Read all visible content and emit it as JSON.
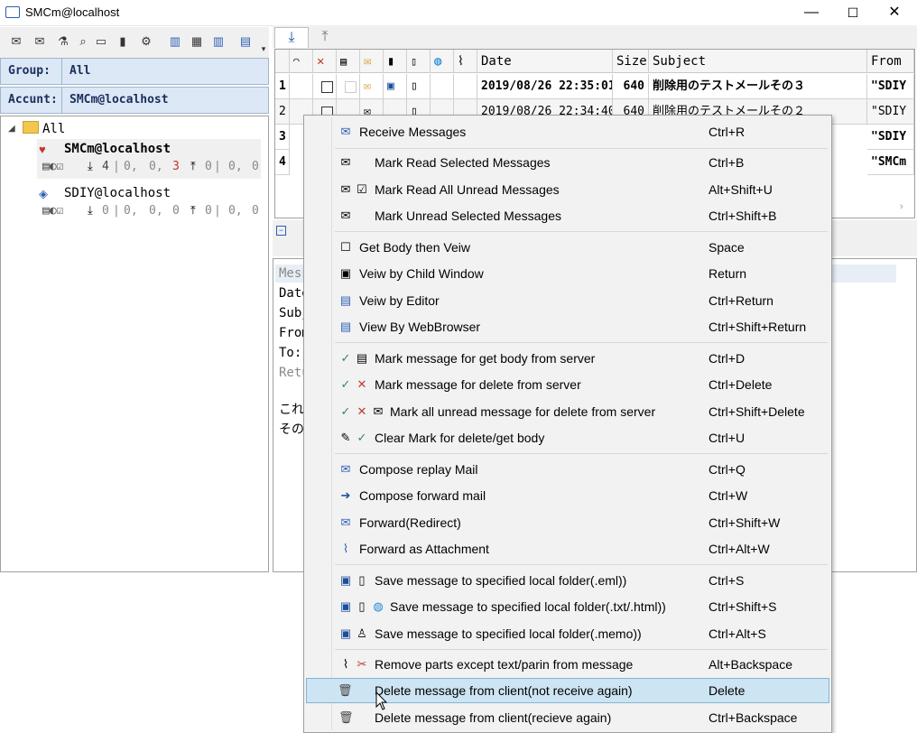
{
  "window": {
    "title": "SMCm@localhost",
    "minimize": "—",
    "maximize": "☐",
    "close": "✕"
  },
  "left": {
    "group_label": "Group:",
    "group_value": "All",
    "account_label": "Accunt:",
    "account_value": "SMCm@localhost",
    "tree": {
      "root": "All",
      "accounts": [
        {
          "name": "SMCm@localhost",
          "in": "4",
          "s1": "0,",
          "s2": "0,",
          "s3": "3",
          "out": "0",
          "o1": "0,",
          "o2": "0"
        },
        {
          "name": "SDIY@localhost",
          "in": "0",
          "s1": "0,",
          "s2": "0,",
          "s3": "0",
          "out": "0",
          "o1": "0,",
          "o2": "0"
        }
      ]
    }
  },
  "grid": {
    "headers": {
      "date": "Date",
      "size": "Size",
      "subject": "Subject",
      "from": "From"
    },
    "rows": [
      {
        "num": "1",
        "date": "2019/08/26 22:35:01",
        "size": "640",
        "subject": "削除用のテストメールその３",
        "from": "\"SDIY"
      },
      {
        "num": "2",
        "date": "2019/08/26 22:34:40",
        "size": "640",
        "subject": "削除用のテストメールその２",
        "from": "\"SDIY"
      },
      {
        "num": "3",
        "date": "",
        "size": "",
        "subject": "",
        "from": "\"SDIY"
      },
      {
        "num": "4",
        "date": "",
        "size": "",
        "subject": "",
        "from": "\"SMCm"
      }
    ]
  },
  "preview": {
    "lines": [
      "Mess",
      "Date",
      "Subj",
      "From",
      "To:",
      "Retu",
      "",
      "これ",
      "その"
    ]
  },
  "menu": {
    "items": [
      {
        "label": "Receive Messages",
        "shortcut": "Ctrl+R"
      },
      {
        "label": "Mark Read Selected Messages",
        "shortcut": "Ctrl+B"
      },
      {
        "label": "Mark Read All Unread Messages",
        "shortcut": "Alt+Shift+U"
      },
      {
        "label": "Mark Unread Selected Messages",
        "shortcut": "Ctrl+Shift+B"
      },
      {
        "label": "Get Body then Veiw",
        "shortcut": "Space"
      },
      {
        "label": "Veiw by Child Window",
        "shortcut": "Return"
      },
      {
        "label": "Veiw by Editor",
        "shortcut": "Ctrl+Return"
      },
      {
        "label": "View By WebBrowser",
        "shortcut": "Ctrl+Shift+Return"
      },
      {
        "label": "Mark message for get body from server",
        "shortcut": "Ctrl+D"
      },
      {
        "label": "Mark message for delete from server",
        "shortcut": "Ctrl+Delete"
      },
      {
        "label": "Mark all unread message for delete from server",
        "shortcut": "Ctrl+Shift+Delete"
      },
      {
        "label": "Clear Mark for delete/get body",
        "shortcut": "Ctrl+U"
      },
      {
        "label": "Compose replay Mail",
        "shortcut": "Ctrl+Q"
      },
      {
        "label": "Compose forward mail",
        "shortcut": "Ctrl+W"
      },
      {
        "label": "Forward(Redirect)",
        "shortcut": "Ctrl+Shift+W"
      },
      {
        "label": "Forward as Attachment",
        "shortcut": "Ctrl+Alt+W"
      },
      {
        "label": "Save message to specified local folder(.eml))",
        "shortcut": "Ctrl+S"
      },
      {
        "label": "Save message to specified local folder(.txt/.html))",
        "shortcut": "Ctrl+Shift+S"
      },
      {
        "label": "Save message to specified local folder(.memo))",
        "shortcut": "Ctrl+Alt+S"
      },
      {
        "label": "Remove parts except text/parin from  message",
        "shortcut": "Alt+Backspace"
      },
      {
        "label": "Delete message from client(not receive again)",
        "shortcut": "Delete"
      },
      {
        "label": "Delete message from client(recieve again)",
        "shortcut": "Ctrl+Backspace"
      }
    ]
  },
  "colors": {
    "accent": "#1a2e5a",
    "highlight": "#cde4f3",
    "check": "#2e8b57",
    "delete_x": "#c0392b",
    "save_blue": "#1b4f9c"
  }
}
